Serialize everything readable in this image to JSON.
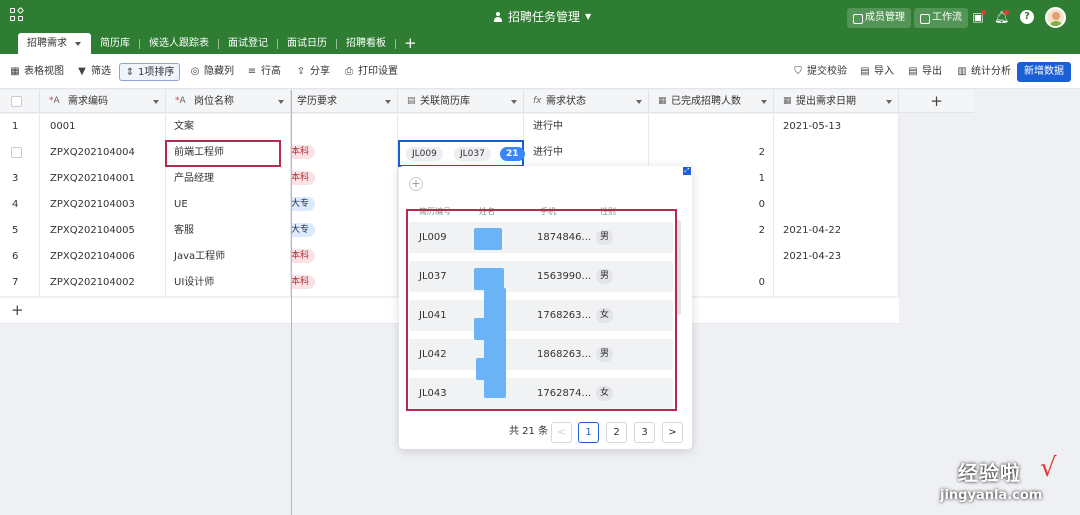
{
  "header": {
    "title": "招聘任务管理",
    "members_label": "成员管理",
    "workflow_label": "工作流",
    "help_label": "?"
  },
  "tabs": [
    {
      "label": "招聘需求"
    },
    {
      "label": "简历库"
    },
    {
      "label": "候选人跟踪表"
    },
    {
      "label": "面试登记"
    },
    {
      "label": "面试日历"
    },
    {
      "label": "招聘看板"
    }
  ],
  "tab_add": "+",
  "toolbar": {
    "table_view": "表格视图",
    "filter": "筛选",
    "sort": "1项排序",
    "hide_cols": "隐藏列",
    "row_height": "行高",
    "share": "分享",
    "print": "打印设置",
    "submit_check": "提交校验",
    "import": "导入",
    "export": "导出",
    "stats": "统计分析",
    "new_data": "新增数据"
  },
  "columns": [
    {
      "label": "需求编码",
      "icon": "A"
    },
    {
      "label": "岗位名称",
      "icon": "A"
    },
    {
      "label": "学历要求",
      "icon": ""
    },
    {
      "label": "关联简历库",
      "icon": ""
    },
    {
      "label": "需求状态",
      "icon": "fx"
    },
    {
      "label": "已完成招聘人数",
      "icon": ""
    },
    {
      "label": "提出需求日期",
      "icon": ""
    }
  ],
  "add_column": "+",
  "rows": [
    {
      "idx": "1",
      "code": "0001",
      "post": "文案",
      "edu": "",
      "status": "进行中",
      "done": "",
      "date": "2021-05-13"
    },
    {
      "idx": "",
      "code": "ZPXQ202104004",
      "post": "前端工程师",
      "edu": "本科",
      "status": "进行中",
      "done": "2",
      "date": ""
    },
    {
      "idx": "3",
      "code": "ZPXQ202104001",
      "post": "产品经理",
      "edu": "本科",
      "status": "",
      "done": "1",
      "date": ""
    },
    {
      "idx": "4",
      "code": "ZPXQ202104003",
      "post": "UE",
      "edu": "大专",
      "status": "",
      "done": "0",
      "date": ""
    },
    {
      "idx": "5",
      "code": "ZPXQ202104005",
      "post": "客服",
      "edu": "大专",
      "status": "",
      "done": "2",
      "date": "2021-04-22"
    },
    {
      "idx": "6",
      "code": "ZPXQ202104006",
      "post": "Java工程师",
      "edu": "本科",
      "status": "",
      "done": "",
      "date": "2021-04-23"
    },
    {
      "idx": "7",
      "code": "ZPXQ202104002",
      "post": "UI设计师",
      "edu": "本科",
      "status": "",
      "done": "0",
      "date": ""
    }
  ],
  "add_row": "+",
  "linked_cell": {
    "tags": [
      "JL009",
      "JL037"
    ],
    "count": "21"
  },
  "popup": {
    "headers": [
      "简历编号",
      "姓名",
      "手机",
      "性别"
    ],
    "rows": [
      {
        "id": "JL009",
        "phone": "1874846...",
        "sex": "男"
      },
      {
        "id": "JL037",
        "phone": "1563990...",
        "sex": "男"
      },
      {
        "id": "JL041",
        "phone": "1768263...",
        "sex": "女"
      },
      {
        "id": "JL042",
        "phone": "1868263...",
        "sex": "男"
      },
      {
        "id": "JL043",
        "phone": "1762874...",
        "sex": "女"
      }
    ],
    "total": "共 21 条",
    "pages": [
      "1",
      "2",
      "3"
    ],
    "prev": "<",
    "next": ">"
  },
  "watermark": {
    "title": "经验啦",
    "url": "jingyanla.com",
    "check": "√"
  },
  "colors": {
    "topbar": "#2e7d32",
    "primary": "#1a5fd6",
    "highlight": "#b52a4f"
  }
}
